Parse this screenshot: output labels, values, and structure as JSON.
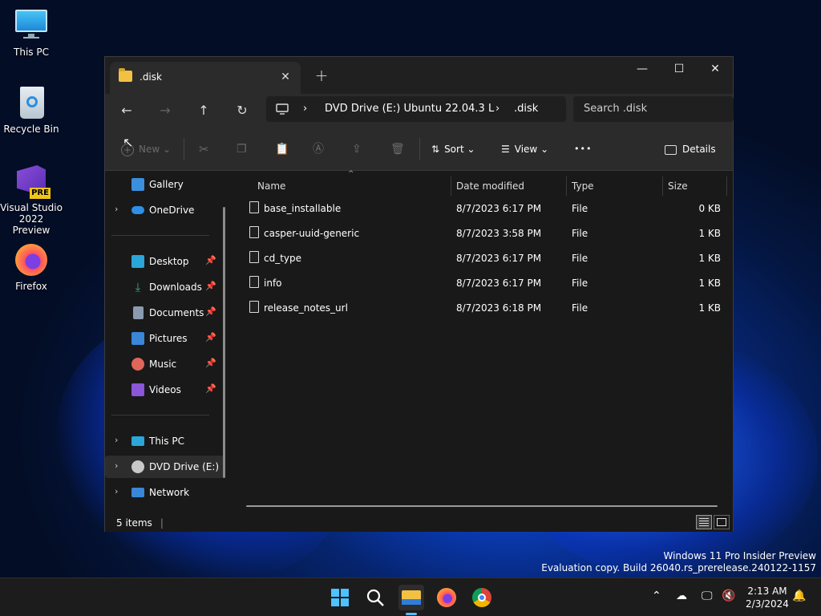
{
  "desktop": {
    "icons": [
      {
        "label": "This PC",
        "icon": "monitor-icon"
      },
      {
        "label": "Recycle Bin",
        "icon": "recycle-bin-icon"
      },
      {
        "label": "Visual Studio 2022 Preview",
        "icon": "visual-studio-icon",
        "badge": "PRE"
      },
      {
        "label": "Firefox",
        "icon": "firefox-icon"
      }
    ]
  },
  "window": {
    "tab_title": ".disk",
    "new_tab_glyph": "+",
    "controls": {
      "minimize": "—",
      "maximize": "☐",
      "close": "✕"
    },
    "address": {
      "drive": "DVD Drive (E:) Ubuntu 22.04.3 L",
      "folder": ".disk",
      "separator": "›"
    },
    "search_placeholder": "Search .disk",
    "command_bar": {
      "new_label": "New",
      "sort_label": "Sort",
      "view_label": "View",
      "more_label": "•••",
      "details_label": "Details"
    },
    "sidebar": {
      "top_items": [
        {
          "label": "Gallery",
          "icon": "gallery-icon",
          "color": "#3b8fdc"
        },
        {
          "label": "OneDrive",
          "icon": "onedrive-icon",
          "color": "#2f8fe8"
        }
      ],
      "pinned_items": [
        {
          "label": "Desktop",
          "icon": "desktop-icon",
          "color": "#2aa7d8"
        },
        {
          "label": "Downloads",
          "icon": "downloads-icon",
          "color": "#35b36a"
        },
        {
          "label": "Documents",
          "icon": "documents-icon",
          "color": "#8a9bb0"
        },
        {
          "label": "Pictures",
          "icon": "pictures-icon",
          "color": "#3a86d8"
        },
        {
          "label": "Music",
          "icon": "music-icon",
          "color": "#e0665a"
        },
        {
          "label": "Videos",
          "icon": "videos-icon",
          "color": "#8b56d8"
        }
      ],
      "bottom_items": [
        {
          "label": "This PC",
          "icon": "this-pc-icon",
          "color": "#2aa7d8"
        },
        {
          "label": "DVD Drive (E:) U",
          "icon": "dvd-icon",
          "color": "#c8c8c8"
        },
        {
          "label": "Network",
          "icon": "network-icon",
          "color": "#3a86d8"
        }
      ]
    },
    "columns": {
      "name": "Name",
      "date": "Date modified",
      "type": "Type",
      "size": "Size"
    },
    "files": [
      {
        "name": "base_installable",
        "date": "8/7/2023 6:17 PM",
        "type": "File",
        "size": "0 KB"
      },
      {
        "name": "casper-uuid-generic",
        "date": "8/7/2023 3:58 PM",
        "type": "File",
        "size": "1 KB"
      },
      {
        "name": "cd_type",
        "date": "8/7/2023 6:17 PM",
        "type": "File",
        "size": "1 KB"
      },
      {
        "name": "info",
        "date": "8/7/2023 6:17 PM",
        "type": "File",
        "size": "1 KB"
      },
      {
        "name": "release_notes_url",
        "date": "8/7/2023 6:18 PM",
        "type": "File",
        "size": "1 KB"
      }
    ],
    "status": "5 items"
  },
  "watermark": {
    "line1": "Windows 11 Pro Insider Preview",
    "line2": "Evaluation copy. Build 26040.rs_prerelease.240122-1157"
  },
  "taskbar": {
    "time": "2:13 AM",
    "date": "2/3/2024",
    "accent": "#4cc2ff"
  }
}
